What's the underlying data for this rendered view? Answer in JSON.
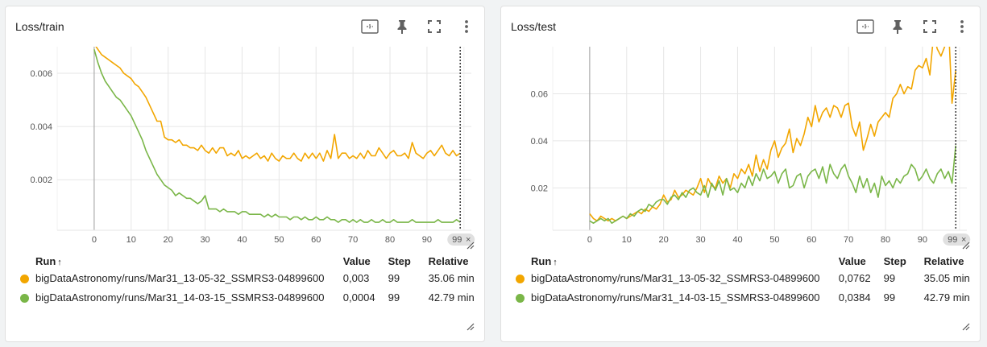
{
  "colors": {
    "run_1": "#f2a600",
    "run_2": "#7ab648"
  },
  "icons": [
    "fit-domain-icon",
    "pin-icon",
    "fullscreen-icon",
    "more-vert-icon"
  ],
  "table_headers": {
    "run": "Run",
    "sort_indicator": "↑",
    "value": "Value",
    "step": "Step",
    "relative": "Relative"
  },
  "step_marker": {
    "label": "99",
    "close": "×"
  },
  "chart_data": [
    {
      "type": "line",
      "title": "Loss/train",
      "xlabel": "",
      "ylabel": "",
      "xlim": [
        -10,
        102
      ],
      "ylim": [
        0.0001,
        0.007
      ],
      "xticks": [
        0,
        10,
        20,
        30,
        40,
        50,
        60,
        70,
        80,
        90
      ],
      "yticks": [
        0.002,
        0.004,
        0.006
      ],
      "ytick_labels": [
        "0.002",
        "0.004",
        "0.006"
      ],
      "grid": true,
      "marker_step": 99,
      "series": [
        {
          "name": "bigDataAstronomy/runs/Mar31_13-05-32_SSMRS3-04899600",
          "color": "#f2a600",
          "x": [
            0,
            1,
            2,
            3,
            4,
            5,
            6,
            7,
            8,
            9,
            10,
            11,
            12,
            13,
            14,
            15,
            16,
            17,
            18,
            19,
            20,
            21,
            22,
            23,
            24,
            25,
            26,
            27,
            28,
            29,
            30,
            31,
            32,
            33,
            34,
            35,
            36,
            37,
            38,
            39,
            40,
            41,
            42,
            43,
            44,
            45,
            46,
            47,
            48,
            49,
            50,
            51,
            52,
            53,
            54,
            55,
            56,
            57,
            58,
            59,
            60,
            61,
            62,
            63,
            64,
            65,
            66,
            67,
            68,
            69,
            70,
            71,
            72,
            73,
            74,
            75,
            76,
            77,
            78,
            79,
            80,
            81,
            82,
            83,
            84,
            85,
            86,
            87,
            88,
            89,
            90,
            91,
            92,
            93,
            94,
            95,
            96,
            97,
            98,
            99
          ],
          "y": [
            0.0071,
            0.0069,
            0.0067,
            0.0066,
            0.0065,
            0.0064,
            0.0063,
            0.0062,
            0.006,
            0.0059,
            0.0058,
            0.0056,
            0.0055,
            0.0053,
            0.0051,
            0.0048,
            0.0045,
            0.0042,
            0.0042,
            0.0036,
            0.0035,
            0.0035,
            0.0034,
            0.0035,
            0.0033,
            0.0033,
            0.0032,
            0.0032,
            0.0031,
            0.0033,
            0.0031,
            0.003,
            0.0032,
            0.003,
            0.0032,
            0.0032,
            0.0029,
            0.003,
            0.0029,
            0.0031,
            0.0028,
            0.0029,
            0.0028,
            0.0029,
            0.003,
            0.0028,
            0.0029,
            0.0027,
            0.003,
            0.0028,
            0.0027,
            0.0029,
            0.0028,
            0.0028,
            0.003,
            0.0028,
            0.0027,
            0.003,
            0.0028,
            0.003,
            0.0028,
            0.003,
            0.0027,
            0.0031,
            0.0028,
            0.0037,
            0.0028,
            0.003,
            0.003,
            0.0028,
            0.0029,
            0.0028,
            0.003,
            0.0028,
            0.0031,
            0.0029,
            0.0029,
            0.0032,
            0.003,
            0.0028,
            0.003,
            0.0031,
            0.0029,
            0.0029,
            0.003,
            0.0028,
            0.0034,
            0.003,
            0.0029,
            0.0028,
            0.003,
            0.0031,
            0.0029,
            0.0031,
            0.0033,
            0.003,
            0.0029,
            0.0031,
            0.0029,
            0.003
          ]
        },
        {
          "name": "bigDataAstronomy/runs/Mar31_14-03-15_SSMRS3-04899600",
          "color": "#7ab648",
          "x": [
            0,
            1,
            2,
            3,
            4,
            5,
            6,
            7,
            8,
            9,
            10,
            11,
            12,
            13,
            14,
            15,
            16,
            17,
            18,
            19,
            20,
            21,
            22,
            23,
            24,
            25,
            26,
            27,
            28,
            29,
            30,
            31,
            32,
            33,
            34,
            35,
            36,
            37,
            38,
            39,
            40,
            41,
            42,
            43,
            44,
            45,
            46,
            47,
            48,
            49,
            50,
            51,
            52,
            53,
            54,
            55,
            56,
            57,
            58,
            59,
            60,
            61,
            62,
            63,
            64,
            65,
            66,
            67,
            68,
            69,
            70,
            71,
            72,
            73,
            74,
            75,
            76,
            77,
            78,
            79,
            80,
            81,
            82,
            83,
            84,
            85,
            86,
            87,
            88,
            89,
            90,
            91,
            92,
            93,
            94,
            95,
            96,
            97,
            98,
            99
          ],
          "y": [
            0.0069,
            0.0064,
            0.006,
            0.0057,
            0.0055,
            0.0053,
            0.0051,
            0.005,
            0.0048,
            0.0046,
            0.0044,
            0.0041,
            0.0038,
            0.0035,
            0.0031,
            0.0028,
            0.0025,
            0.0022,
            0.002,
            0.0018,
            0.0017,
            0.0016,
            0.0014,
            0.0015,
            0.0014,
            0.0013,
            0.0013,
            0.0012,
            0.0011,
            0.0012,
            0.0014,
            0.0009,
            0.0009,
            0.0009,
            0.0008,
            0.0009,
            0.0008,
            0.0008,
            0.0008,
            0.0007,
            0.0008,
            0.0008,
            0.0007,
            0.0007,
            0.0007,
            0.0007,
            0.0006,
            0.0007,
            0.0006,
            0.0007,
            0.0006,
            0.0006,
            0.0006,
            0.0005,
            0.0006,
            0.0006,
            0.0005,
            0.0006,
            0.0005,
            0.0005,
            0.0006,
            0.0005,
            0.0005,
            0.0006,
            0.0005,
            0.0005,
            0.0004,
            0.0005,
            0.0005,
            0.0004,
            0.0005,
            0.0004,
            0.0005,
            0.0004,
            0.0004,
            0.0005,
            0.0004,
            0.0004,
            0.0005,
            0.0004,
            0.0004,
            0.0005,
            0.0004,
            0.0004,
            0.0004,
            0.0004,
            0.0005,
            0.0004,
            0.0004,
            0.0004,
            0.0004,
            0.0004,
            0.0004,
            0.0005,
            0.0004,
            0.0004,
            0.0004,
            0.0004,
            0.0005,
            0.0004
          ]
        }
      ],
      "table": [
        {
          "run": "bigDataAstronomy/runs/Mar31_13-05-32_SSMRS3-04899600",
          "value": "0,003",
          "step": "99",
          "relative": "35.06 min"
        },
        {
          "run": "bigDataAstronomy/runs/Mar31_14-03-15_SSMRS3-04899600",
          "value": "0,0004",
          "step": "99",
          "relative": "42.79 min"
        }
      ]
    },
    {
      "type": "line",
      "title": "Loss/test",
      "xlabel": "",
      "ylabel": "",
      "xlim": [
        -10,
        102
      ],
      "ylim": [
        0.002,
        0.08
      ],
      "xticks": [
        0,
        10,
        20,
        30,
        40,
        50,
        60,
        70,
        80,
        90
      ],
      "yticks": [
        0.02,
        0.04,
        0.06
      ],
      "ytick_labels": [
        "0.02",
        "0.04",
        "0.06"
      ],
      "grid": true,
      "marker_step": 99,
      "series": [
        {
          "name": "bigDataAstronomy/runs/Mar31_13-05-32_SSMRS3-04899600",
          "color": "#f2a600",
          "x": [
            0,
            1,
            2,
            3,
            4,
            5,
            6,
            7,
            8,
            9,
            10,
            11,
            12,
            13,
            14,
            15,
            16,
            17,
            18,
            19,
            20,
            21,
            22,
            23,
            24,
            25,
            26,
            27,
            28,
            29,
            30,
            31,
            32,
            33,
            34,
            35,
            36,
            37,
            38,
            39,
            40,
            41,
            42,
            43,
            44,
            45,
            46,
            47,
            48,
            49,
            50,
            51,
            52,
            53,
            54,
            55,
            56,
            57,
            58,
            59,
            60,
            61,
            62,
            63,
            64,
            65,
            66,
            67,
            68,
            69,
            70,
            71,
            72,
            73,
            74,
            75,
            76,
            77,
            78,
            79,
            80,
            81,
            82,
            83,
            84,
            85,
            86,
            87,
            88,
            89,
            90,
            91,
            92,
            93,
            94,
            95,
            96,
            97,
            98,
            99
          ],
          "y": [
            0.009,
            0.007,
            0.006,
            0.008,
            0.007,
            0.006,
            0.007,
            0.006,
            0.007,
            0.008,
            0.007,
            0.008,
            0.009,
            0.01,
            0.009,
            0.011,
            0.01,
            0.012,
            0.011,
            0.013,
            0.017,
            0.014,
            0.015,
            0.019,
            0.016,
            0.017,
            0.019,
            0.018,
            0.017,
            0.02,
            0.024,
            0.018,
            0.024,
            0.021,
            0.02,
            0.025,
            0.022,
            0.024,
            0.02,
            0.026,
            0.024,
            0.028,
            0.026,
            0.03,
            0.025,
            0.034,
            0.027,
            0.032,
            0.028,
            0.036,
            0.04,
            0.033,
            0.037,
            0.039,
            0.045,
            0.035,
            0.041,
            0.038,
            0.043,
            0.05,
            0.046,
            0.055,
            0.048,
            0.052,
            0.054,
            0.05,
            0.055,
            0.054,
            0.05,
            0.055,
            0.056,
            0.046,
            0.042,
            0.048,
            0.036,
            0.041,
            0.047,
            0.042,
            0.048,
            0.05,
            0.052,
            0.05,
            0.058,
            0.06,
            0.064,
            0.06,
            0.063,
            0.062,
            0.07,
            0.072,
            0.071,
            0.075,
            0.068,
            0.085,
            0.079,
            0.076,
            0.08,
            0.09,
            0.056,
            0.07
          ]
        },
        {
          "name": "bigDataAstronomy/runs/Mar31_14-03-15_SSMRS3-04899600",
          "color": "#7ab648",
          "x": [
            0,
            1,
            2,
            3,
            4,
            5,
            6,
            7,
            8,
            9,
            10,
            11,
            12,
            13,
            14,
            15,
            16,
            17,
            18,
            19,
            20,
            21,
            22,
            23,
            24,
            25,
            26,
            27,
            28,
            29,
            30,
            31,
            32,
            33,
            34,
            35,
            36,
            37,
            38,
            39,
            40,
            41,
            42,
            43,
            44,
            45,
            46,
            47,
            48,
            49,
            50,
            51,
            52,
            53,
            54,
            55,
            56,
            57,
            58,
            59,
            60,
            61,
            62,
            63,
            64,
            65,
            66,
            67,
            68,
            69,
            70,
            71,
            72,
            73,
            74,
            75,
            76,
            77,
            78,
            79,
            80,
            81,
            82,
            83,
            84,
            85,
            86,
            87,
            88,
            89,
            90,
            91,
            92,
            93,
            94,
            95,
            96,
            97,
            98,
            99
          ],
          "y": [
            0.006,
            0.005,
            0.006,
            0.007,
            0.006,
            0.007,
            0.005,
            0.006,
            0.007,
            0.008,
            0.007,
            0.009,
            0.008,
            0.01,
            0.011,
            0.01,
            0.013,
            0.012,
            0.014,
            0.015,
            0.015,
            0.013,
            0.016,
            0.017,
            0.015,
            0.018,
            0.016,
            0.019,
            0.02,
            0.018,
            0.017,
            0.021,
            0.016,
            0.022,
            0.019,
            0.023,
            0.017,
            0.024,
            0.019,
            0.02,
            0.018,
            0.022,
            0.02,
            0.025,
            0.021,
            0.026,
            0.023,
            0.028,
            0.024,
            0.025,
            0.027,
            0.022,
            0.026,
            0.028,
            0.02,
            0.021,
            0.025,
            0.026,
            0.02,
            0.025,
            0.027,
            0.028,
            0.024,
            0.029,
            0.022,
            0.03,
            0.026,
            0.024,
            0.028,
            0.03,
            0.025,
            0.022,
            0.018,
            0.025,
            0.02,
            0.024,
            0.018,
            0.022,
            0.016,
            0.025,
            0.021,
            0.023,
            0.02,
            0.024,
            0.022,
            0.025,
            0.026,
            0.03,
            0.028,
            0.023,
            0.025,
            0.028,
            0.024,
            0.022,
            0.026,
            0.028,
            0.024,
            0.027,
            0.022,
            0.038
          ]
        }
      ],
      "table": [
        {
          "run": "bigDataAstronomy/runs/Mar31_13-05-32_SSMRS3-04899600",
          "value": "0,0762",
          "step": "99",
          "relative": "35.05 min"
        },
        {
          "run": "bigDataAstronomy/runs/Mar31_14-03-15_SSMRS3-04899600",
          "value": "0,0384",
          "step": "99",
          "relative": "42.79 min"
        }
      ]
    }
  ]
}
